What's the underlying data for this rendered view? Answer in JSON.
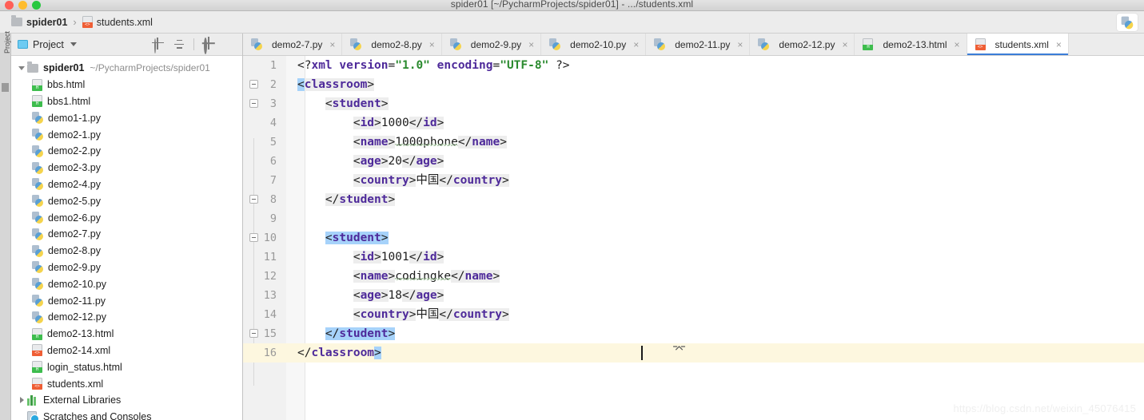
{
  "window": {
    "title": "spider01 [~/PycharmProjects/spider01] - .../students.xml",
    "traffic_lights": [
      "close",
      "minimize",
      "zoom"
    ],
    "colors": {
      "accent": "#3b7dd8",
      "current_line": "#fdf7df",
      "match_highlight": "#a6d2fa"
    }
  },
  "breadcrumb": {
    "project": "spider01",
    "separator": "›",
    "file": "students.xml",
    "run_button_icon": "python-icon"
  },
  "left_strip": {
    "vertical_tab": "Project"
  },
  "project_panel": {
    "header": {
      "title": "Project",
      "icon": "project-icon",
      "caret": "chevron-down-icon",
      "tools": [
        "locate-icon",
        "collapse-all-icon",
        "gear-icon",
        "minimize-icon"
      ]
    },
    "tree": [
      {
        "label": "spider01",
        "hint": "~/PycharmProjects/spider01",
        "icon": "folder-icon",
        "twisty": "down",
        "bold": true,
        "indent": 0
      },
      {
        "label": "bbs.html",
        "icon": "html-icon",
        "indent": 1
      },
      {
        "label": "bbs1.html",
        "icon": "html-icon",
        "indent": 1
      },
      {
        "label": "demo1-1.py",
        "icon": "python-icon",
        "indent": 1
      },
      {
        "label": "demo2-1.py",
        "icon": "python-icon",
        "indent": 1
      },
      {
        "label": "demo2-2.py",
        "icon": "python-icon",
        "indent": 1
      },
      {
        "label": "demo2-3.py",
        "icon": "python-icon",
        "indent": 1
      },
      {
        "label": "demo2-4.py",
        "icon": "python-icon",
        "indent": 1
      },
      {
        "label": "demo2-5.py",
        "icon": "python-icon",
        "indent": 1
      },
      {
        "label": "demo2-6.py",
        "icon": "python-icon",
        "indent": 1
      },
      {
        "label": "demo2-7.py",
        "icon": "python-icon",
        "indent": 1
      },
      {
        "label": "demo2-8.py",
        "icon": "python-icon",
        "indent": 1
      },
      {
        "label": "demo2-9.py",
        "icon": "python-icon",
        "indent": 1
      },
      {
        "label": "demo2-10.py",
        "icon": "python-icon",
        "indent": 1
      },
      {
        "label": "demo2-11.py",
        "icon": "python-icon",
        "indent": 1
      },
      {
        "label": "demo2-12.py",
        "icon": "python-icon",
        "indent": 1
      },
      {
        "label": "demo2-13.html",
        "icon": "html-icon",
        "indent": 1
      },
      {
        "label": "demo2-14.xml",
        "icon": "xml-icon",
        "indent": 1
      },
      {
        "label": "login_status.html",
        "icon": "html-icon",
        "indent": 1
      },
      {
        "label": "students.xml",
        "icon": "xml-icon",
        "indent": 1
      },
      {
        "label": "External Libraries",
        "icon": "library-icon",
        "twisty": "right",
        "indent": 0
      },
      {
        "label": "Scratches and Consoles",
        "icon": "scratches-icon",
        "indent": 0
      }
    ]
  },
  "editor": {
    "tabs": [
      {
        "label": "demo2-7.py",
        "icon": "python-icon",
        "active": false,
        "close": "×"
      },
      {
        "label": "demo2-8.py",
        "icon": "python-icon",
        "active": false,
        "close": "×"
      },
      {
        "label": "demo2-9.py",
        "icon": "python-icon",
        "active": false,
        "close": "×"
      },
      {
        "label": "demo2-10.py",
        "icon": "python-icon",
        "active": false,
        "close": "×"
      },
      {
        "label": "demo2-11.py",
        "icon": "python-icon",
        "active": false,
        "close": "×"
      },
      {
        "label": "demo2-12.py",
        "icon": "python-icon",
        "active": false,
        "close": "×"
      },
      {
        "label": "demo2-13.html",
        "icon": "html-icon",
        "active": false,
        "close": "×"
      },
      {
        "label": "students.xml",
        "icon": "xml-icon",
        "active": true,
        "close": "×"
      }
    ],
    "active_file": "students.xml",
    "current_line": 16,
    "caret_line": 16,
    "line_numbers": [
      1,
      2,
      3,
      4,
      5,
      6,
      7,
      8,
      9,
      10,
      11,
      12,
      13,
      14,
      15,
      16
    ],
    "code_lines": [
      {
        "n": 1,
        "text": "<?xml version=\"1.0\" encoding=\"UTF-8\" ?>"
      },
      {
        "n": 2,
        "text": "<classroom>"
      },
      {
        "n": 3,
        "text": "    <student>"
      },
      {
        "n": 4,
        "text": "        <id>1000</id>"
      },
      {
        "n": 5,
        "text": "        <name>1000phone</name>"
      },
      {
        "n": 6,
        "text": "        <age>20</age>"
      },
      {
        "n": 7,
        "text": "        <country>中国</country>"
      },
      {
        "n": 8,
        "text": "    </student>"
      },
      {
        "n": 9,
        "text": ""
      },
      {
        "n": 10,
        "text": "    <student>"
      },
      {
        "n": 11,
        "text": "        <id>1001</id>"
      },
      {
        "n": 12,
        "text": "        <name>codingke</name>"
      },
      {
        "n": 13,
        "text": "        <age>18</age>"
      },
      {
        "n": 14,
        "text": "        <country>中国</country>"
      },
      {
        "n": 15,
        "text": "    </student>"
      },
      {
        "n": 16,
        "text": "</classroom>"
      }
    ],
    "tokens": {
      "xml_decl_open": "<?",
      "xml_decl_name": "xml",
      "attr_version": "version",
      "attr_version_value": "\"1.0\"",
      "attr_encoding": "encoding",
      "attr_encoding_value": "\"UTF-8\"",
      "xml_decl_close": "?>",
      "tag_classroom": "classroom",
      "tag_student": "student",
      "tag_id": "id",
      "tag_name": "name",
      "tag_age": "age",
      "tag_country": "country",
      "value_id_1": "1000",
      "value_name_1": "1000phone",
      "value_age_1": "20",
      "value_country_1": "中国",
      "value_id_2": "1001",
      "value_name_2": "codingke",
      "value_age_2": "18",
      "value_country_2": "中国"
    }
  },
  "watermark": "https://blog.csdn.net/weixin_45076415"
}
